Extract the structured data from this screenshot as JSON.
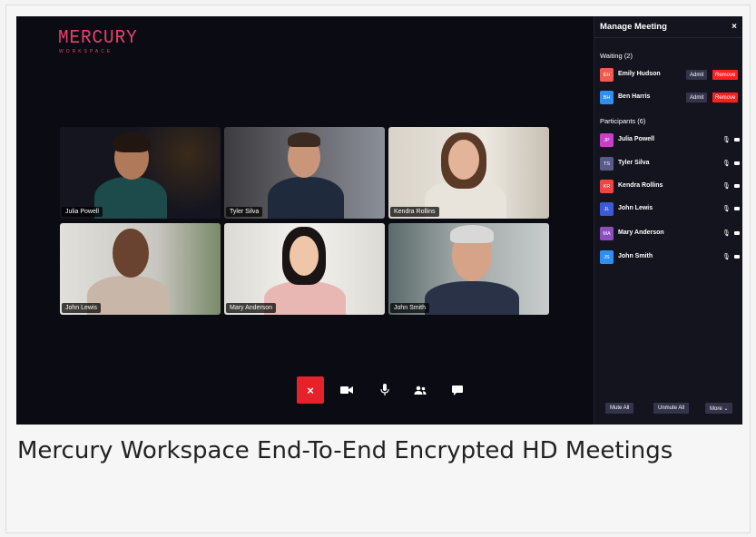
{
  "app": {
    "logo_main": "MERCURY",
    "logo_sub": "WORKSPACE"
  },
  "video_tiles": [
    {
      "name": "Julia Powell"
    },
    {
      "name": "Tyler Silva"
    },
    {
      "name": "Kendra Rollins"
    },
    {
      "name": "John Lewis"
    },
    {
      "name": "Mary Anderson"
    },
    {
      "name": "John Smith"
    }
  ],
  "controls": {
    "end_call": "×",
    "camera_icon": "video-camera-icon",
    "mic_icon": "microphone-icon",
    "people_icon": "people-icon",
    "chat_icon": "chat-bubble-icon"
  },
  "panel": {
    "title": "Manage Meeting",
    "close": "×",
    "waiting_label": "Waiting (2)",
    "admit_label": "Admit",
    "remove_label": "Remove",
    "waiting": [
      {
        "initials": "EH",
        "name": "Emily Hudson",
        "color": "#f05a4f"
      },
      {
        "initials": "BH",
        "name": "Ben Harris",
        "color": "#2f8ff0"
      }
    ],
    "participants_label": "Participants (6)",
    "participants": [
      {
        "initials": "JP",
        "name": "Julia Powell",
        "color": "#c93fc9"
      },
      {
        "initials": "TS",
        "name": "Tyler Silva",
        "color": "#5a5a8a"
      },
      {
        "initials": "KR",
        "name": "Kendra Rollins",
        "color": "#f04545"
      },
      {
        "initials": "JL",
        "name": "John Lewis",
        "color": "#3d5ad6"
      },
      {
        "initials": "MA",
        "name": "Mary Anderson",
        "color": "#8d4fc0"
      },
      {
        "initials": "JS",
        "name": "John Smith",
        "color": "#2f8ff0"
      }
    ],
    "mute_all": "Mute All",
    "unmute_all": "Unmute All",
    "more": "More ⌄"
  },
  "caption": "Mercury Workspace End-To-End Encrypted HD Meetings",
  "colors": {
    "accent": "#e9406a",
    "end_call": "#e5212a",
    "remove": "#ff1f1f",
    "background": "#0b0b14"
  }
}
